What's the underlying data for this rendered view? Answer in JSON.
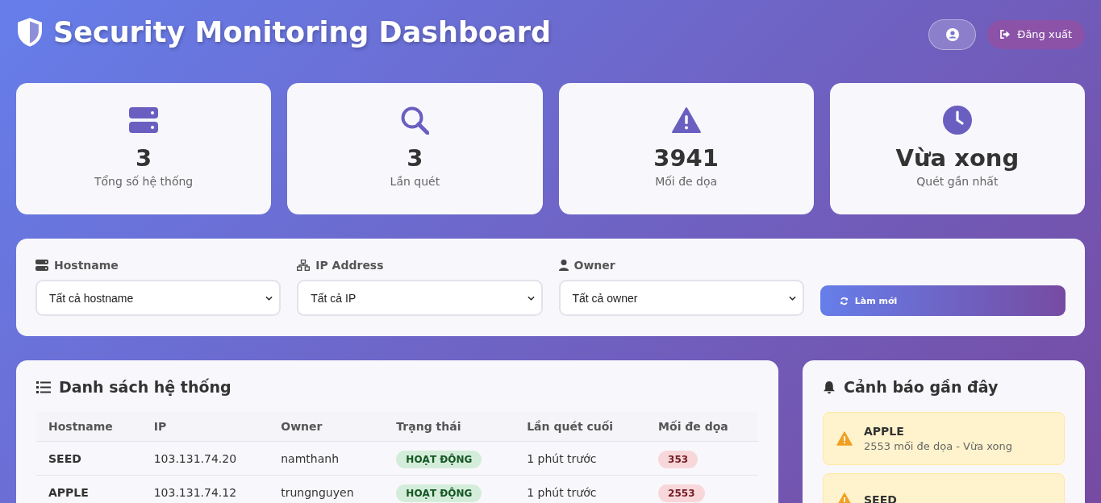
{
  "header": {
    "title": "Security Monitoring Dashboard",
    "logout": "Đăng xuất"
  },
  "stats": [
    {
      "value": "3",
      "label": "Tổng số hệ thống"
    },
    {
      "value": "3",
      "label": "Lần quét"
    },
    {
      "value": "3941",
      "label": "Mối đe dọa"
    },
    {
      "value": "Vừa xong",
      "label": "Quét gần nhất"
    }
  ],
  "filters": [
    {
      "label": "Hostname",
      "value": "Tất cả hostname"
    },
    {
      "label": "IP Address",
      "value": "Tất cả IP"
    },
    {
      "label": "Owner",
      "value": "Tất cả owner"
    }
  ],
  "refresh_button": "Làm mới",
  "systems": {
    "title": "Danh sách hệ thống",
    "columns": [
      "Hostname",
      "IP",
      "Owner",
      "Trạng thái",
      "Lần quét cuối",
      "Mối đe dọa"
    ],
    "rows": [
      {
        "hostname": "SEED",
        "ip": "103.131.74.20",
        "owner": "namthanh",
        "status": "HOẠT ĐỘNG",
        "last_scan": "1 phút trước",
        "threats": "353"
      },
      {
        "hostname": "APPLE",
        "ip": "103.131.74.12",
        "owner": "trungnguyen",
        "status": "HOẠT ĐỘNG",
        "last_scan": "1 phút trước",
        "threats": "2553"
      }
    ]
  },
  "alerts": {
    "title": "Cảnh báo gần đây",
    "items": [
      {
        "host": "APPLE",
        "detail": "2553 mối đe dọa - Vừa xong"
      },
      {
        "host": "SEED"
      }
    ]
  }
}
